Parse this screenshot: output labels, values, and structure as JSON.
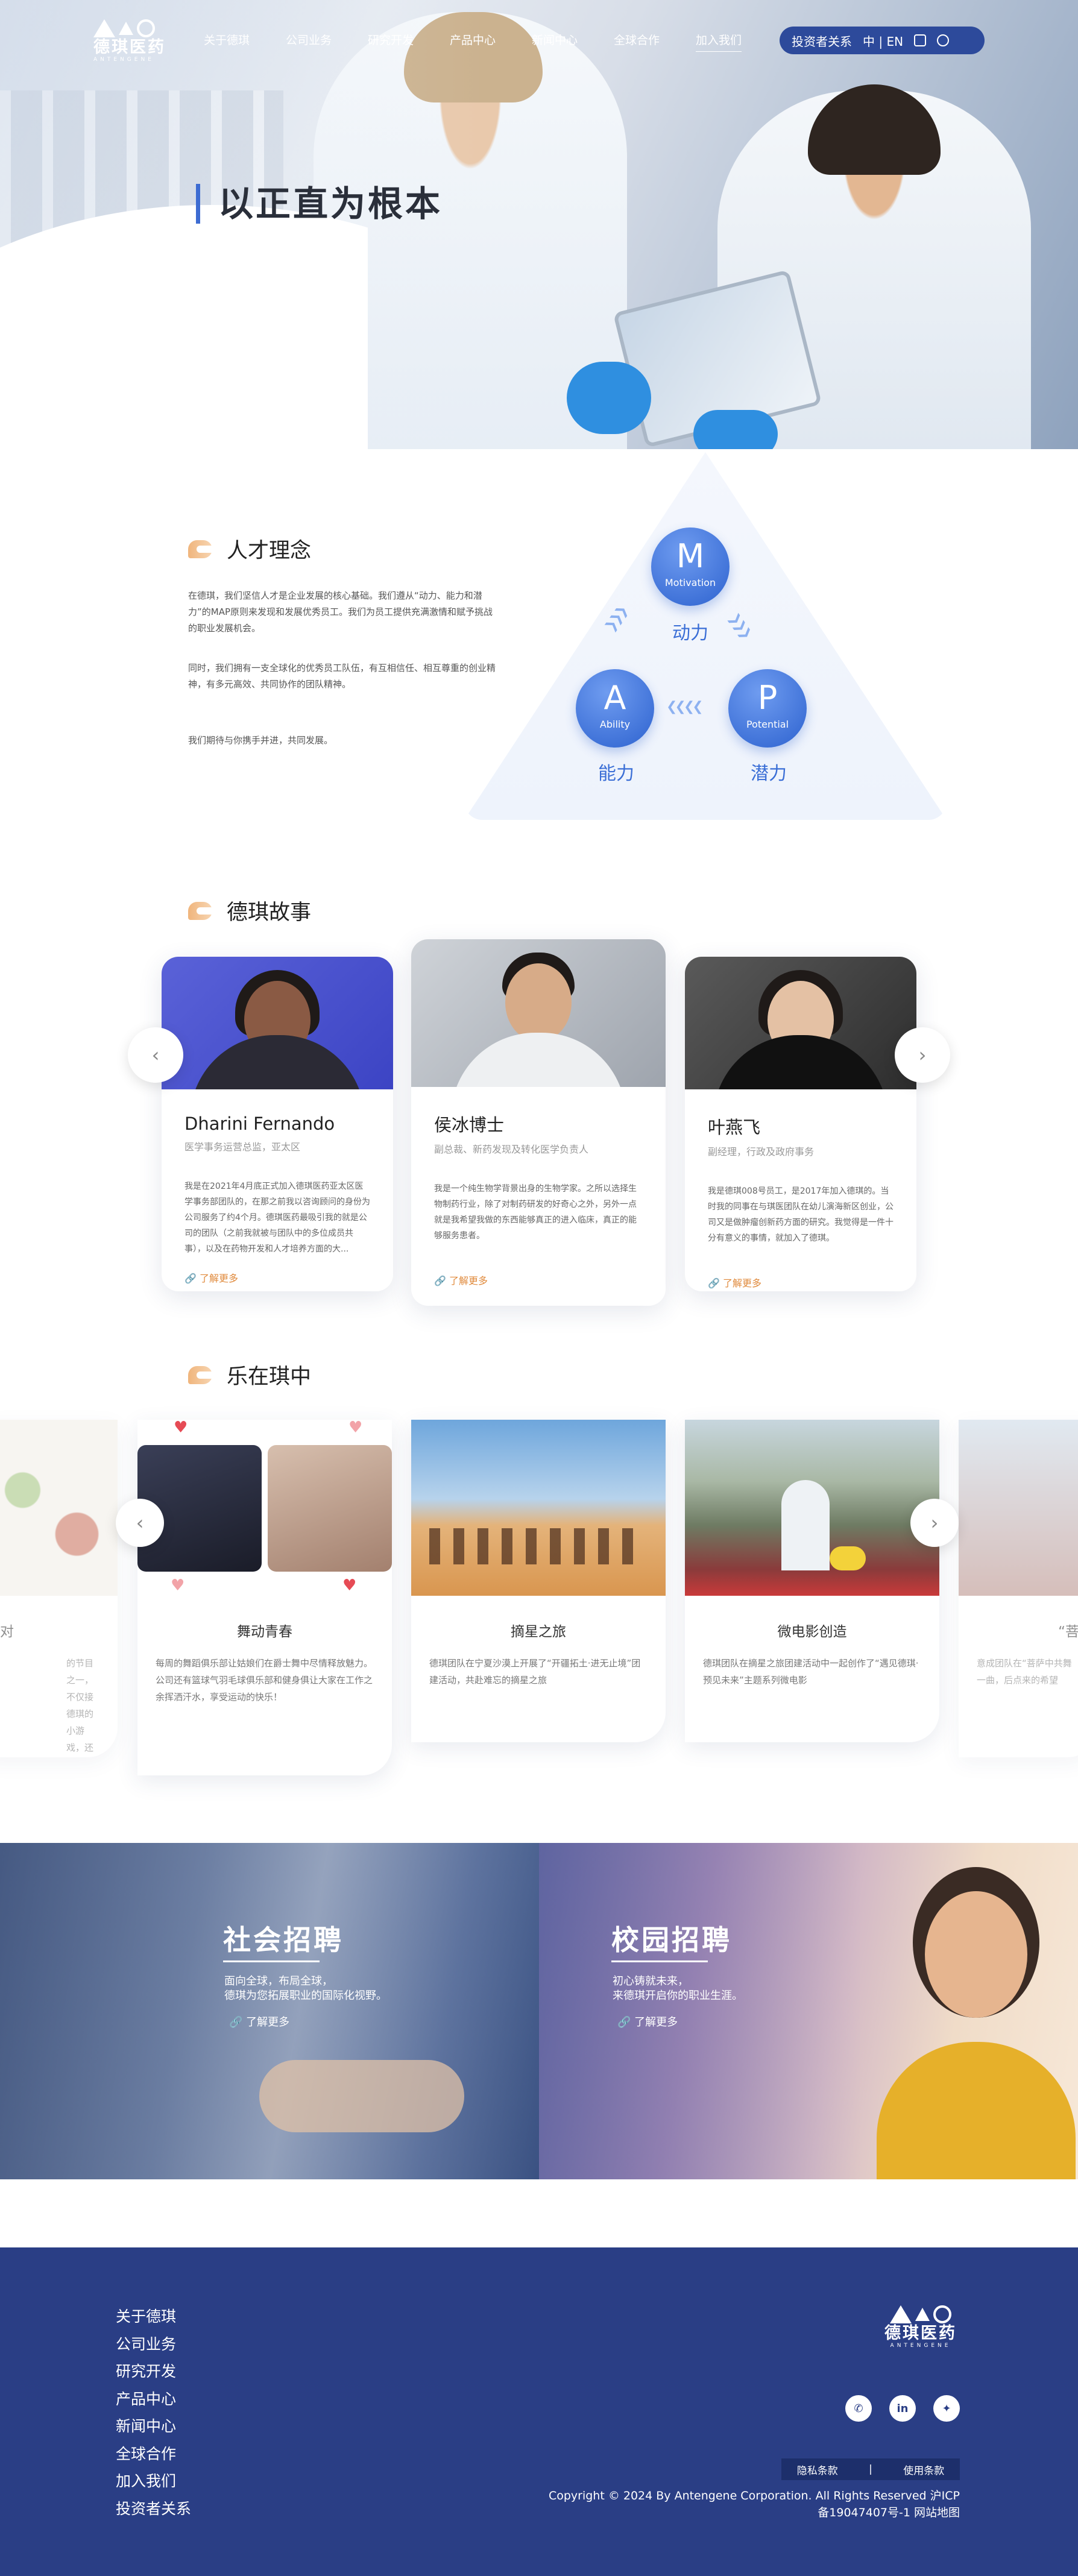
{
  "nav": {
    "logo_cn": "德琪医药",
    "logo_en": "ANTENGENE",
    "items": [
      "关于德琪",
      "公司业务",
      "研究开发",
      "产品中心",
      "新闻中心",
      "全球合作",
      "加入我们"
    ],
    "active": "加入我们",
    "investor": "投资者关系",
    "lang": "中 | EN"
  },
  "hero": {
    "title": "以正直为根本"
  },
  "talent": {
    "heading": "人才理念",
    "p1": "在德琪，我们坚信人才是企业发展的核心基础。我们遵从“动力、能力和潜力”的MAP原则来发现和发展优秀员工。我们为员工提供充满激情和赋予挑战的职业发展机会。",
    "p2": "同时，我们拥有一支全球化的优秀员工队伍，有互相信任、相互尊重的创业精神，有多元高效、共同协作的团队精神。",
    "p3": "我们期待与你携手并进，共同发展。",
    "map": {
      "m_letter": "M",
      "m_word": "Motivation",
      "m_label": "动力",
      "a_letter": "A",
      "a_word": "Ability",
      "a_label": "能力",
      "p_letter": "P",
      "p_word": "Potential",
      "p_label": "潜力"
    }
  },
  "stories": {
    "heading": "德琪故事",
    "more": "了解更多",
    "cards": [
      {
        "name": "Dharini Fernando",
        "title": "医学事务运营总监，亚太区",
        "desc": "我是在2021年4月底正式加入德琪医药亚太区医学事务部团队的，在那之前我以咨询顾问的身份为公司服务了约4个月。德琪医药最吸引我的就是公司的团队（之前我就被与团队中的多位成员共事），以及在药物开发和人才培养方面的大..."
      },
      {
        "name": "侯冰博士",
        "title": "副总裁、新药发现及转化医学负责人",
        "desc": "我是一个纯生物学背景出身的生物学家。之所以选择生物制药行业，除了对制药研发的好奇心之外，另外一点就是我希望我做的东西能够真正的进入临床，真正的能够服务患者。"
      },
      {
        "name": "叶燕飞",
        "title": "副经理，行政及政府事务",
        "desc": "我是德琪008号员工，是2017年加入德琪的。当时我的同事在与琪医团队在幼儿演海新区创业，公司又是做肿瘤创新药方面的研究。我觉得是一件十分有意义的事情，就加入了德琪。"
      }
    ]
  },
  "fun": {
    "heading": "乐在琪中",
    "left_partial": "对",
    "left_desc": "的节目之一，不仅接德琪的小游戏，还能",
    "right_partial": "“菩",
    "right_desc": "意成团队在“菩萨中共舞一曲，后点来的希望",
    "cards": [
      {
        "title": "舞动青春",
        "desc": "每周的舞蹈俱乐部让姑娘们在爵士舞中尽情释放魅力。公司还有篮球气羽毛球俱乐部和健身俱让大家在工作之余挥洒汗水，享受运动的快乐！"
      },
      {
        "title": "摘星之旅",
        "desc": "德琪团队在宁夏沙漠上开展了“开疆拓土·进无止境”团建活动，共赴难忘的摘星之旅"
      },
      {
        "title": "微电影创造",
        "desc": "德琪团队在摘星之旅团建活动中一起创作了“遇见德琪·预见未来”主题系列微电影"
      }
    ]
  },
  "recruit": {
    "social": {
      "title": "社会招聘",
      "desc1": "面向全球，布局全球，",
      "desc2": "德琪为您拓展职业的国际化视野。",
      "more": "了解更多"
    },
    "campus": {
      "title": "校园招聘",
      "desc1": "初心铸就未来，",
      "desc2": "来德琪开启你的职业生涯。",
      "more": "了解更多"
    }
  },
  "footer": {
    "links": [
      "关于德琪",
      "公司业务",
      "研究开发",
      "产品中心",
      "新闻中心",
      "全球合作",
      "加入我们",
      "投资者关系"
    ],
    "logo_cn": "德琪医药",
    "logo_en": "ANTENGENE",
    "privacy": "隐私条款",
    "terms": "使用条款",
    "copyright": "Copyright © 2024 By Antengene Corporation. All Rights Reserved 沪ICP",
    "icp": "备19047407号-1 网站地图"
  },
  "colors": {
    "brand": "#2a3e85",
    "accent": "#3d6cd2",
    "orange": "#e08a3c"
  }
}
